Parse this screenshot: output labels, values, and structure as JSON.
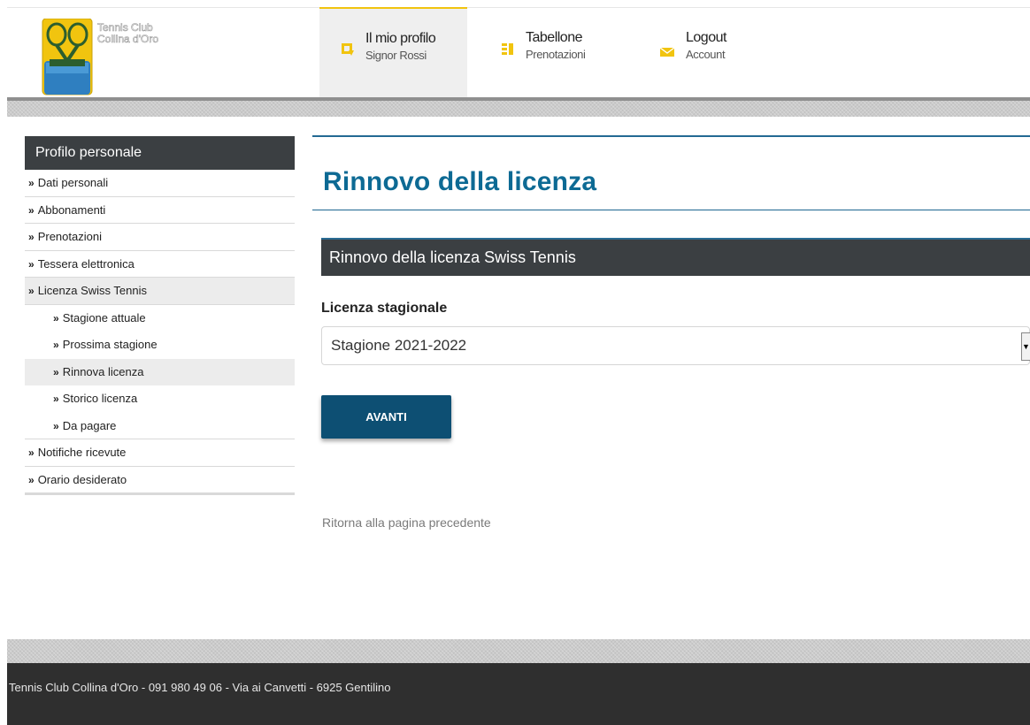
{
  "brand": {
    "logo_text_line1": "Tennis Club",
    "logo_text_line2": "Collina d'Oro",
    "colors": {
      "accent_yellow": "#f1c40f",
      "primary_blue": "#0d6a94",
      "dark_bar": "#3b3f42",
      "button_blue": "#0d4f73"
    }
  },
  "header": {
    "nav": [
      {
        "title": "Il mio profilo",
        "sub": "Signor Rossi",
        "icon": "profile-arrow-icon",
        "active": true
      },
      {
        "title": "Tabellone",
        "sub": "Prenotazioni",
        "icon": "schedule-board-icon",
        "active": false
      },
      {
        "title": "Logout",
        "sub": "Account",
        "icon": "envelope-icon",
        "active": false
      }
    ]
  },
  "sidebar": {
    "heading": "Profilo personale",
    "bullet": "»",
    "items": [
      {
        "label": "Dati personali"
      },
      {
        "label": "Abbonamenti"
      },
      {
        "label": "Prenotazioni"
      },
      {
        "label": "Tessera elettronica"
      },
      {
        "label": "Licenza Swiss Tennis"
      },
      {
        "label": "Stagione attuale"
      },
      {
        "label": "Prossima stagione"
      },
      {
        "label": "Rinnova licenza"
      },
      {
        "label": "Storico licenza"
      },
      {
        "label": "Da pagare"
      },
      {
        "label": "Notifiche ricevute"
      },
      {
        "label": "Orario desiderato"
      }
    ]
  },
  "main": {
    "title": "Rinnovo della licenza",
    "section_heading": "Rinnovo della licenza Swiss Tennis",
    "field_label": "Licenza stagionale",
    "select_value": "Stagione 2021-2022",
    "next_button": "AVANTI",
    "back_link": "Ritorna alla pagina precedente"
  },
  "footer": {
    "text": "Tennis Club Collina d'Oro - 091 980 49 06 - Via ai Canvetti - 6925 Gentilino"
  }
}
